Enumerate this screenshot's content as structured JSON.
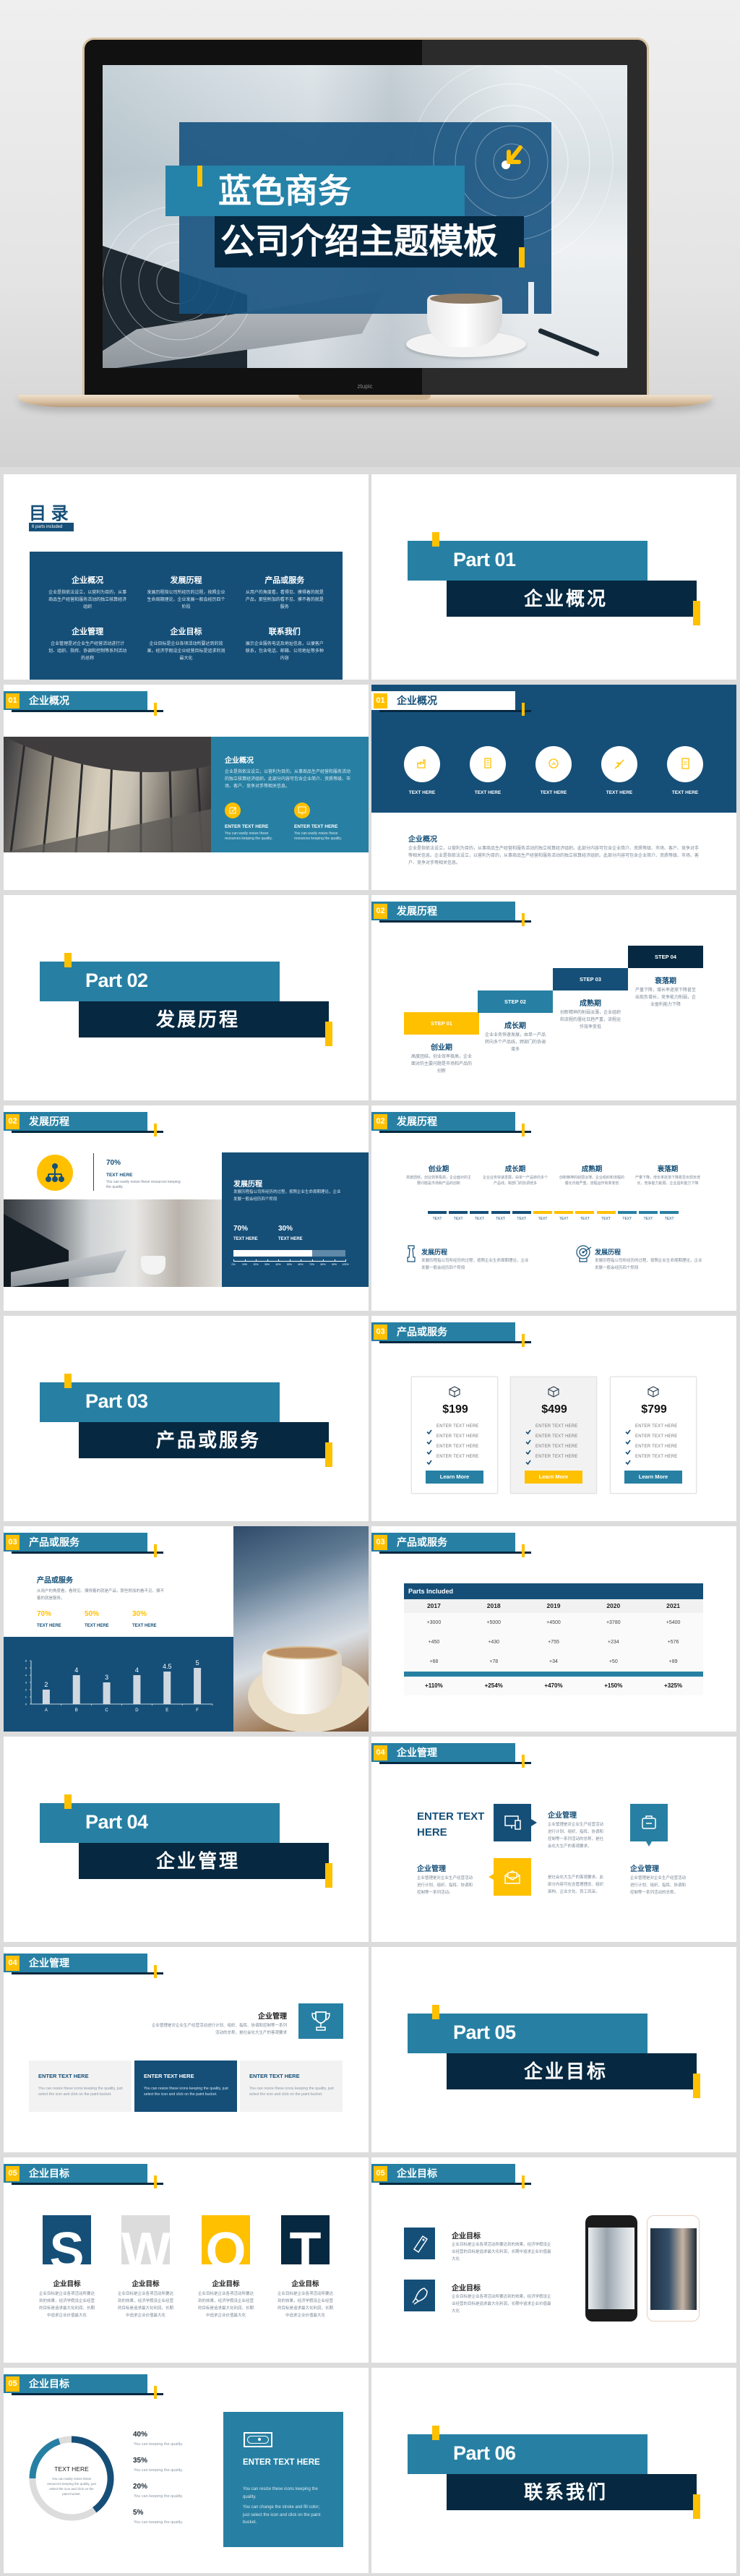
{
  "colors": {
    "teal": "#2780a3",
    "navy": "#154f78",
    "dark": "#062840",
    "yellow": "#ffc000",
    "light_gray": "#f2f2f2"
  },
  "hero": {
    "title_line1": "蓝色商务",
    "title_line2": "公司介绍主题模板",
    "laptop_brand": "ztupic"
  },
  "section_headers": [
    {
      "num": "01",
      "title": "企业概况"
    },
    {
      "num": "02",
      "title": "发展历程"
    },
    {
      "num": "03",
      "title": "产品或服务"
    },
    {
      "num": "04",
      "title": "企业管理"
    },
    {
      "num": "05",
      "title": "企业目标"
    }
  ],
  "parts": [
    {
      "label": "Part 01",
      "title": "企业概况"
    },
    {
      "label": "Part 02",
      "title": "发展历程"
    },
    {
      "label": "Part 03",
      "title": "产品或服务"
    },
    {
      "label": "Part 04",
      "title": "企业管理"
    },
    {
      "label": "Part 05",
      "title": "企业目标"
    },
    {
      "label": "Part 06",
      "title": "联系我们"
    }
  ],
  "toc": {
    "title": "目 录",
    "subtitle": "6 parts included",
    "items": [
      {
        "title": "企业概况",
        "desc": "企业是指依法设立，以营利为目的，从事商品生产经营和服务活动的独立核算经济组织"
      },
      {
        "title": "发展历程",
        "desc": "发展历程指公司所经历的过程，按照企业生命周期理论，企业发展一般会经历四个阶段"
      },
      {
        "title": "产品或服务",
        "desc": "从用户的角度看，看得见、摸得着的就是产品，那些附加的看不见、摸不着的就是服务"
      },
      {
        "title": "企业管理",
        "desc": "企业管理是对企业生产经营活动进行计划、组织、指挥、协调和控制等系列活动的总称"
      },
      {
        "title": "企业目标",
        "desc": "企业目标是企业各项活动所要达到的效果，经济学假设企业经营目标是追求利润最大化"
      },
      {
        "title": "联系我们",
        "desc": "展示企业服务电话及地址信息，以便客户联系，包含电话、邮箱、公司地址等多种内容"
      }
    ]
  },
  "overview_photo": {
    "title": "企业概况",
    "desc": "企业是指依法设立，以营利为目的，从事商品生产经营和服务活动的独立核算经济组织。此部分内容可包含企业简介、资质等级、市场、客户、竞争对手等相关信息。",
    "features": [
      {
        "icon": "edit-icon",
        "title": "ENTER TEXT HERE",
        "desc": "You can easily resize these resources keeping the quality."
      },
      {
        "icon": "presentation-icon",
        "title": "ENTER TEXT HERE",
        "desc": "You can easily resize these resources keeping the quality."
      }
    ]
  },
  "overview_icons": {
    "icons": [
      {
        "icon": "factory-icon",
        "label": "TEXT HERE"
      },
      {
        "icon": "building-icon",
        "label": "TEXT HERE"
      },
      {
        "icon": "chat-chart-icon",
        "label": "TEXT HERE"
      },
      {
        "icon": "airplane-icon",
        "label": "TEXT HERE"
      },
      {
        "icon": "document-icon",
        "label": "TEXT HERE"
      }
    ],
    "title": "企业概况",
    "desc": "企业是指依法设立，以营利为目的，从事商品生产经营和服务活动的独立核算经济组织。此部分内容可包含企业简介、资质等级、市场、客户、竞争对手等相关信息。企业是指依法设立，以营利为目的，从事商品生产经营和服务活动的独立核算经济组织。此部分内容可包含企业简介、资质等级、市场、客户、竞争对手等相关信息。"
  },
  "steps": {
    "items": [
      {
        "step": "STEP 01",
        "title": "创业期",
        "desc": "高度团结，创业效率极高，企业面对的主要问题是市场和产品的创新"
      },
      {
        "step": "STEP 02",
        "title": "成长期",
        "desc": "企业业务快速发展，由单一产品转向多个产品线，跨部门的协调增多"
      },
      {
        "step": "STEP 03",
        "title": "成熟期",
        "desc": "创新精神的削弱淡薄，企业组织和流程的僵化日趋严重，流程运作效率变低"
      },
      {
        "step": "STEP 04",
        "title": "衰落期",
        "desc": "产量下降，增长率逐渐下降甚至出现负增长，竞争能力削弱，企业盈利能力下降"
      }
    ]
  },
  "history_photo": {
    "stat": "70%",
    "stat_label": "TEXT HERE",
    "stat_desc": "You can easily resize these resources keeping the quality.",
    "panel_title": "发展历程",
    "panel_desc": "发展历程指公司所经历的过程，按照企业生命周期理论，企业发展一般会经历四个阶段",
    "stats": [
      {
        "value": "70%",
        "label": "TEXT HERE"
      },
      {
        "value": "30%",
        "label": "TEXT HERE"
      }
    ],
    "progress_percent": 70,
    "scale": [
      "0%",
      "10%",
      "20%",
      "30%",
      "40%",
      "50%",
      "60%",
      "70%",
      "80%",
      "90%",
      "100%"
    ]
  },
  "timeline": {
    "phases": [
      {
        "title": "创业期",
        "desc": "高度团结，创业效率极高，企业面对的主要问题是市场和产品的创新"
      },
      {
        "title": "成长期",
        "desc": "企业业务快速发展，由单一产品转向多个产品线，跨部门的协调增多"
      },
      {
        "title": "成熟期",
        "desc": "创新精神的削弱淡薄，企业组织和流程的僵化日趋严重，流程运作效率变低"
      },
      {
        "title": "衰落期",
        "desc": "产量下降，增长率逐渐下降甚至出现负增长，竞争能力削弱，企业盈利能力下降"
      }
    ],
    "segments": [
      {
        "label": "TEXT",
        "color": "#154f78"
      },
      {
        "label": "TEXT",
        "color": "#154f78"
      },
      {
        "label": "TEXT",
        "color": "#154f78"
      },
      {
        "label": "TEXT",
        "color": "#154f78"
      },
      {
        "label": "TEXT",
        "color": "#154f78"
      },
      {
        "label": "TEXT",
        "color": "#ffc000"
      },
      {
        "label": "TEXT",
        "color": "#ffc000"
      },
      {
        "label": "TEXT",
        "color": "#ffc000"
      },
      {
        "label": "TEXT",
        "color": "#ffc000"
      },
      {
        "label": "TEXT",
        "color": "#2780a3"
      },
      {
        "label": "TEXT",
        "color": "#2780a3"
      },
      {
        "label": "TEXT",
        "color": "#2780a3"
      }
    ],
    "items": [
      {
        "icon": "chess-rook-icon",
        "title": "发展历程",
        "desc": "发展历程指公司所经历的过程，按照企业生命周期理论，企业发展一般会经历四个阶段"
      },
      {
        "icon": "target-icon",
        "title": "发展历程",
        "desc": "发展历程指公司所经历的过程，按照企业生命周期理论，企业发展一般会经历四个阶段"
      }
    ]
  },
  "pricing": {
    "plans": [
      {
        "price": "$199",
        "features": [
          "ENTER TEXT HERE",
          "ENTER TEXT HERE",
          "ENTER TEXT HERE",
          "ENTER TEXT HERE"
        ],
        "button": "Learn More",
        "highlight": false
      },
      {
        "price": "$499",
        "features": [
          "ENTER TEXT HERE",
          "ENTER TEXT HERE",
          "ENTER TEXT HERE",
          "ENTER TEXT HERE"
        ],
        "button": "Learn More",
        "highlight": true
      },
      {
        "price": "$799",
        "features": [
          "ENTER TEXT HERE",
          "ENTER TEXT HERE",
          "ENTER TEXT HERE",
          "ENTER TEXT HERE"
        ],
        "button": "Learn More",
        "highlight": false
      }
    ]
  },
  "product_chart": {
    "title": "产品或服务",
    "desc": "从用户的角度看，看得见、摸得着的就是产品，那些附加的看不见、摸不着的就是服务。",
    "stats": [
      {
        "value": "70%",
        "label": "TEXT HERE"
      },
      {
        "value": "50%",
        "label": "TEXT HERE"
      },
      {
        "value": "30%",
        "label": "TEXT HERE"
      }
    ]
  },
  "chart_data": {
    "type": "bar",
    "categories": [
      "A",
      "B",
      "C",
      "D",
      "E",
      "F"
    ],
    "values": [
      2,
      4,
      3,
      4,
      4.5,
      5
    ],
    "ylim": [
      0,
      6
    ],
    "yticks": [
      0,
      1,
      2,
      3,
      4,
      5,
      6
    ],
    "title": "",
    "xlabel": "",
    "ylabel": "",
    "grid": false,
    "data_labels": true
  },
  "table": {
    "title": "Parts Included",
    "columns": [
      "2017",
      "2018",
      "2019",
      "2020",
      "2021"
    ],
    "rows": [
      [
        "+3000",
        "+5000",
        "+4500",
        "+3780",
        "+5400"
      ],
      [
        "+450",
        "+430",
        "+755",
        "+234",
        "+576"
      ],
      [
        "+68",
        "+78",
        "+34",
        "+50",
        "+89"
      ]
    ],
    "totals": [
      "+110%",
      "+254%",
      "+470%",
      "+150%",
      "+325%"
    ]
  },
  "management_icons": {
    "headline": "ENTER TEXT HERE",
    "blocks": [
      {
        "icon": "devices-icon",
        "title": "企业管理",
        "desc": "企业管理是对企业生产经营活动进行计划、组织、指挥、协调和控制等一系列活动的总称，是社会化大生产的客观要求。"
      },
      {
        "icon": "mail-icon",
        "title": "企业管理",
        "desc": "企业管理是对企业生产经营活动进行计划、组织、指挥、协调和控制等一系列活动。"
      },
      {
        "icon": "briefcase-icon",
        "title": "企业管理",
        "desc": "企业管理是对企业生产经营活动进行计划、组织、指挥、协调和控制等一系列活动的总称。"
      }
    ],
    "middle_desc": "是社会化大生产的客观要求。此部分内容可包含管理理念、组织架构、企业文化、员工风采。"
  },
  "management_cards": {
    "title": "企业管理",
    "desc": "企业管理是对企业生产经营活动进行计划、组织、指挥、协调和控制等一系列活动的总称，是社会化大生产的客观要求",
    "icon": "trophy-icon",
    "cards": [
      {
        "title": "ENTER TEXT HERE",
        "desc": "You can resize these icons keeping the quality, just select the icon and click on the paint bucket."
      },
      {
        "title": "ENTER TEXT HERE",
        "desc": "You can resize these icons keeping the quality, just select the icon and click on the paint bucket."
      },
      {
        "title": "ENTER TEXT HERE",
        "desc": "You can resize these icons keeping the quality, just select the icon and click on the paint bucket."
      }
    ]
  },
  "swot": {
    "items": [
      {
        "letter": "S",
        "title": "企业目标",
        "desc": "企业目标是企业各项活动所要达到的效果，经济学假设企业经营的目标是追求最大化利润，长期中追求企业价值最大化"
      },
      {
        "letter": "W",
        "title": "企业目标",
        "desc": "企业目标是企业各项活动所要达到的效果，经济学假设企业经营的目标是追求最大化利润，长期中追求企业价值最大化"
      },
      {
        "letter": "O",
        "title": "企业目标",
        "desc": "企业目标是企业各项活动所要达到的效果，经济学假设企业经营的目标是追求最大化利润，长期中追求企业价值最大化"
      },
      {
        "letter": "T",
        "title": "企业目标",
        "desc": "企业目标是企业各项活动所要达到的效果，经济学假设企业经营的目标是追求最大化利润，长期中追求企业价值最大化"
      }
    ]
  },
  "goals": {
    "items": [
      {
        "icon": "tag-icon",
        "title": "企业目标",
        "desc": "企业目标是企业各项活动所要达到的效果，经济学假设企业经营的目标是追求最大化利润，长期中追求企业价值最大化"
      },
      {
        "icon": "rocket-icon",
        "title": "企业目标",
        "desc": "企业目标是企业各项活动所要达到的效果，经济学假设企业经营的目标是追求最大化利润，长期中追求企业价值最大化"
      }
    ]
  },
  "donut": {
    "center_title": "TEXT HERE",
    "center_desc": "You can easily resize these resources keeping the quality, just select the icon and click on the paint bucket.",
    "legend": [
      {
        "value": "40%",
        "desc": "You can keeping the quality."
      },
      {
        "value": "35%",
        "desc": "You can keeping the quality."
      },
      {
        "value": "20%",
        "desc": "You can keeping the quality."
      },
      {
        "value": "5%",
        "desc": "You can keeping the quality."
      }
    ],
    "segments": [
      {
        "percent": 40,
        "color": "#154f78"
      },
      {
        "percent": 35,
        "color": "#dcdcdc"
      },
      {
        "percent": 20,
        "color": "#2780a3"
      },
      {
        "percent": 5,
        "color": "#dcdcdc"
      }
    ],
    "panel": {
      "icon": "money-icon",
      "title": "ENTER TEXT HERE",
      "desc1": "You can resize these icons keeping the quality.",
      "desc2": "You can change the stroke and fill color; just select the icon and click on the paint bucket."
    }
  }
}
